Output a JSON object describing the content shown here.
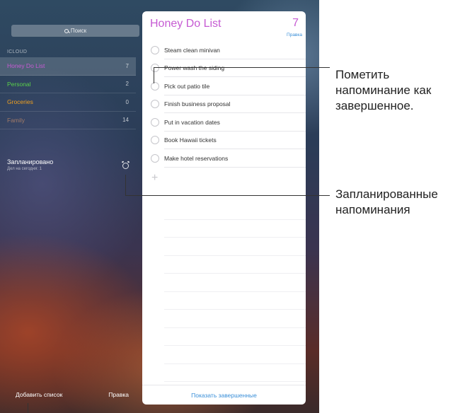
{
  "search": {
    "placeholder": "Поиск"
  },
  "sidebar": {
    "section_label": "ICLOUD",
    "lists": [
      {
        "name": "Honey Do List",
        "count": "7",
        "color": "#c65bd3",
        "active": true
      },
      {
        "name": "Personal",
        "count": "2",
        "color": "#5ad04a",
        "active": false
      },
      {
        "name": "Groceries",
        "count": "0",
        "color": "#f0a020",
        "active": false
      },
      {
        "name": "Family",
        "count": "14",
        "color": "#a07a68",
        "active": false
      }
    ],
    "scheduled": {
      "title": "Запланировано",
      "subtitle": "Дел на сегодня: 1",
      "icon": "alarm-clock-icon"
    },
    "bottom": {
      "add_list": "Добавить список",
      "edit": "Правка"
    }
  },
  "card": {
    "title": "Honey Do List",
    "count": "7",
    "edit": "Правка",
    "accent": "#c65bd3",
    "link_color": "#3a8fd8",
    "items": [
      "Steam clean minivan",
      "Power wash the siding",
      "Pick out patio tile",
      "Finish business proposal",
      "Put in vacation dates",
      "Book Hawaii tickets",
      "Make hotel reservations"
    ],
    "show_completed": "Показать завершенные"
  },
  "callouts": {
    "mark_complete": [
      "Пометить",
      "напоминание как",
      "завершенное."
    ],
    "scheduled": [
      "Запланированные",
      "напоминания"
    ]
  }
}
